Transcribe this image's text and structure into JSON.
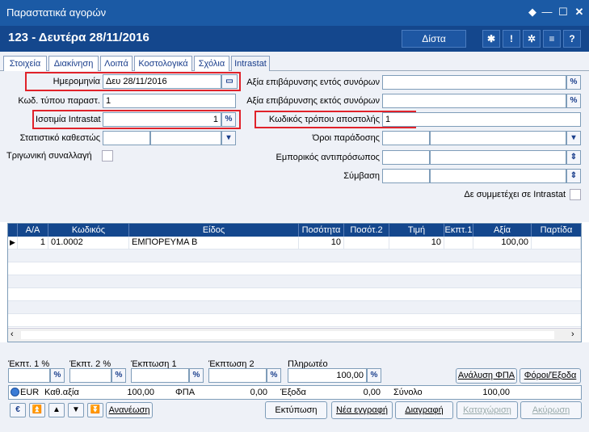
{
  "window": {
    "title": "Παραστατικά αγορών"
  },
  "header": {
    "title": "123 - Δευτέρα 28/11/2016",
    "currency_button": "Δίστα"
  },
  "tabs": [
    "Στοιχεία",
    "Διακίνηση",
    "Λοιπά",
    "Κοστολογικά",
    "Σχόλια",
    "Intrastat"
  ],
  "form": {
    "date_label": "Ημερομηνία",
    "date_value": "Δευ 28/11/2016",
    "doc_type_label": "Κωδ. τύπου παραστ.",
    "doc_type_value": "1",
    "intrastat_parity_label": "Ισοτιμία Intrastat",
    "intrastat_parity_value": "1",
    "stat_regime_label": "Στατιστικό καθεστώς",
    "triangular_label": "Τριγωνική συναλλαγή",
    "charge_inside_label": "Αξία επιβάρυνσης εντός συνόρων",
    "charge_outside_label": "Αξία επιβάρυνσης εκτός συνόρων",
    "shipping_code_label": "Κωδικός τρόπου αποστολής",
    "shipping_code_value": "1",
    "delivery_terms_label": "Όροι παράδοσης",
    "agent_label": "Εμπορικός αντιπρόσωπος",
    "contract_label": "Σύμβαση",
    "not_in_intrastat_label": "Δε συμμετέχει σε Intrastat",
    "percent_icon": "%"
  },
  "grid": {
    "columns": [
      "Α/Α",
      "Κωδικός",
      "Είδος",
      "Ποσότητα",
      "Ποσότ.2",
      "Τιμή",
      "Εκπτ.1",
      "Αξία",
      "Παρτίδα"
    ],
    "rows": [
      {
        "aa": "1",
        "code": "01.0002",
        "item": "ΕΜΠΟΡΕΥΜΑ Β",
        "qty": "10",
        "qty2": "",
        "price": "10",
        "disc1": "",
        "value": "100,00",
        "lot": ""
      }
    ]
  },
  "discounts": {
    "disc1_pct_label": "Έκπτ. 1 %",
    "disc2_pct_label": "Έκπτ. 2 %",
    "disc1_label": "Έκπτωση 1",
    "disc2_label": "Έκπτωση 2",
    "payable_label": "Πληρωτέο",
    "payable_value": "100,00",
    "vat_analysis_button": "Ανάλυση ΦΠΑ",
    "taxes_button": "Φόροι/Έξοδα"
  },
  "totals": {
    "currency": "EUR",
    "net_label": "Καθ.αξία",
    "net_value": "100,00",
    "vat_label": "ΦΠΑ",
    "vat_value": "0,00",
    "expenses_label": "Έξοδα",
    "expenses_value": "0,00",
    "total_label": "Σύνολο",
    "total_value": "100,00"
  },
  "footer": {
    "refresh": "Ανανέωση",
    "print": "Εκτύπωση",
    "new": "Νέα εγγραφή",
    "delete": "Διαγραφή",
    "save": "Καταχώριση",
    "cancel": "Ακύρωση",
    "euro_symbol": "€"
  }
}
